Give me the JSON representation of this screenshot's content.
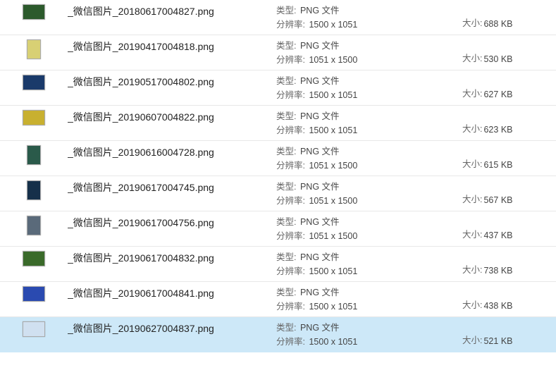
{
  "labels": {
    "type": "类型:",
    "resolution": "分辨率:",
    "size": "大小:"
  },
  "files": [
    {
      "name": "_微信图片_20180617004827.png",
      "type": "PNG 文件",
      "resolution": "1500 x 1051",
      "size": "688 KB",
      "orientation": "landscape",
      "thumb_bg": "#2c5a2c",
      "selected": false
    },
    {
      "name": "_微信图片_20190417004818.png",
      "type": "PNG 文件",
      "resolution": "1051 x 1500",
      "size": "530 KB",
      "orientation": "portrait",
      "thumb_bg": "#d8d074",
      "selected": false
    },
    {
      "name": "_微信图片_20190517004802.png",
      "type": "PNG 文件",
      "resolution": "1500 x 1051",
      "size": "627 KB",
      "orientation": "landscape",
      "thumb_bg": "#1a3a6a",
      "selected": false
    },
    {
      "name": "_微信图片_20190607004822.png",
      "type": "PNG 文件",
      "resolution": "1500 x 1051",
      "size": "623 KB",
      "orientation": "landscape",
      "thumb_bg": "#c8b030",
      "selected": false
    },
    {
      "name": "_微信图片_20190616004728.png",
      "type": "PNG 文件",
      "resolution": "1051 x 1500",
      "size": "615 KB",
      "orientation": "portrait",
      "thumb_bg": "#2a5a4a",
      "selected": false
    },
    {
      "name": "_微信图片_20190617004745.png",
      "type": "PNG 文件",
      "resolution": "1051 x 1500",
      "size": "567 KB",
      "orientation": "portrait",
      "thumb_bg": "#16304a",
      "selected": false
    },
    {
      "name": "_微信图片_20190617004756.png",
      "type": "PNG 文件",
      "resolution": "1051 x 1500",
      "size": "437 KB",
      "orientation": "portrait",
      "thumb_bg": "#5a6a7a",
      "selected": false
    },
    {
      "name": "_微信图片_20190617004832.png",
      "type": "PNG 文件",
      "resolution": "1500 x 1051",
      "size": "738 KB",
      "orientation": "landscape",
      "thumb_bg": "#3a6a2a",
      "selected": false
    },
    {
      "name": "_微信图片_20190617004841.png",
      "type": "PNG 文件",
      "resolution": "1500 x 1051",
      "size": "438 KB",
      "orientation": "landscape",
      "thumb_bg": "#2a4ab0",
      "selected": false
    },
    {
      "name": "_微信图片_20190627004837.png",
      "type": "PNG 文件",
      "resolution": "1500 x 1051",
      "size": "521 KB",
      "orientation": "landscape",
      "thumb_bg": "#d0e0f0",
      "selected": true
    }
  ]
}
